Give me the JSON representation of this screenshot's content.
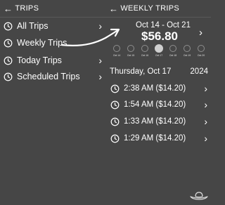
{
  "left_header": {
    "title": "TRIPS"
  },
  "menu": [
    {
      "label": "All Trips"
    },
    {
      "label": "Weekly Trips"
    },
    {
      "label": "Today Trips"
    },
    {
      "label": "Scheduled Trips"
    }
  ],
  "right_header": {
    "title": "WEEKLY TRIPS"
  },
  "week": {
    "range": "Oct 14 - Oct 21",
    "total": "$56.80",
    "days": [
      "Oct 14",
      "Oct 15",
      "Oct 16",
      "Oct 17",
      "Oct 18",
      "Oct 19",
      "Oct 20"
    ],
    "selected_day": "Oct 17"
  },
  "selected_date": {
    "day": "Thursday, Oct 17",
    "year": "2024"
  },
  "trips": [
    {
      "label": "2:38 AM ($14.20)"
    },
    {
      "label": "1:54 AM ($14.20)"
    },
    {
      "label": "1:33 AM ($14.20)"
    },
    {
      "label": "1:29 AM ($14.20)"
    }
  ],
  "icons": {
    "back": "back-arrow-icon",
    "clock": "clock-icon",
    "chevron": "chevron-right-icon",
    "next_week": "arrow-right-icon",
    "logo": "cowboy-hat-logo-icon"
  },
  "colors": {
    "background": "#464646",
    "text": "#ffffff"
  }
}
